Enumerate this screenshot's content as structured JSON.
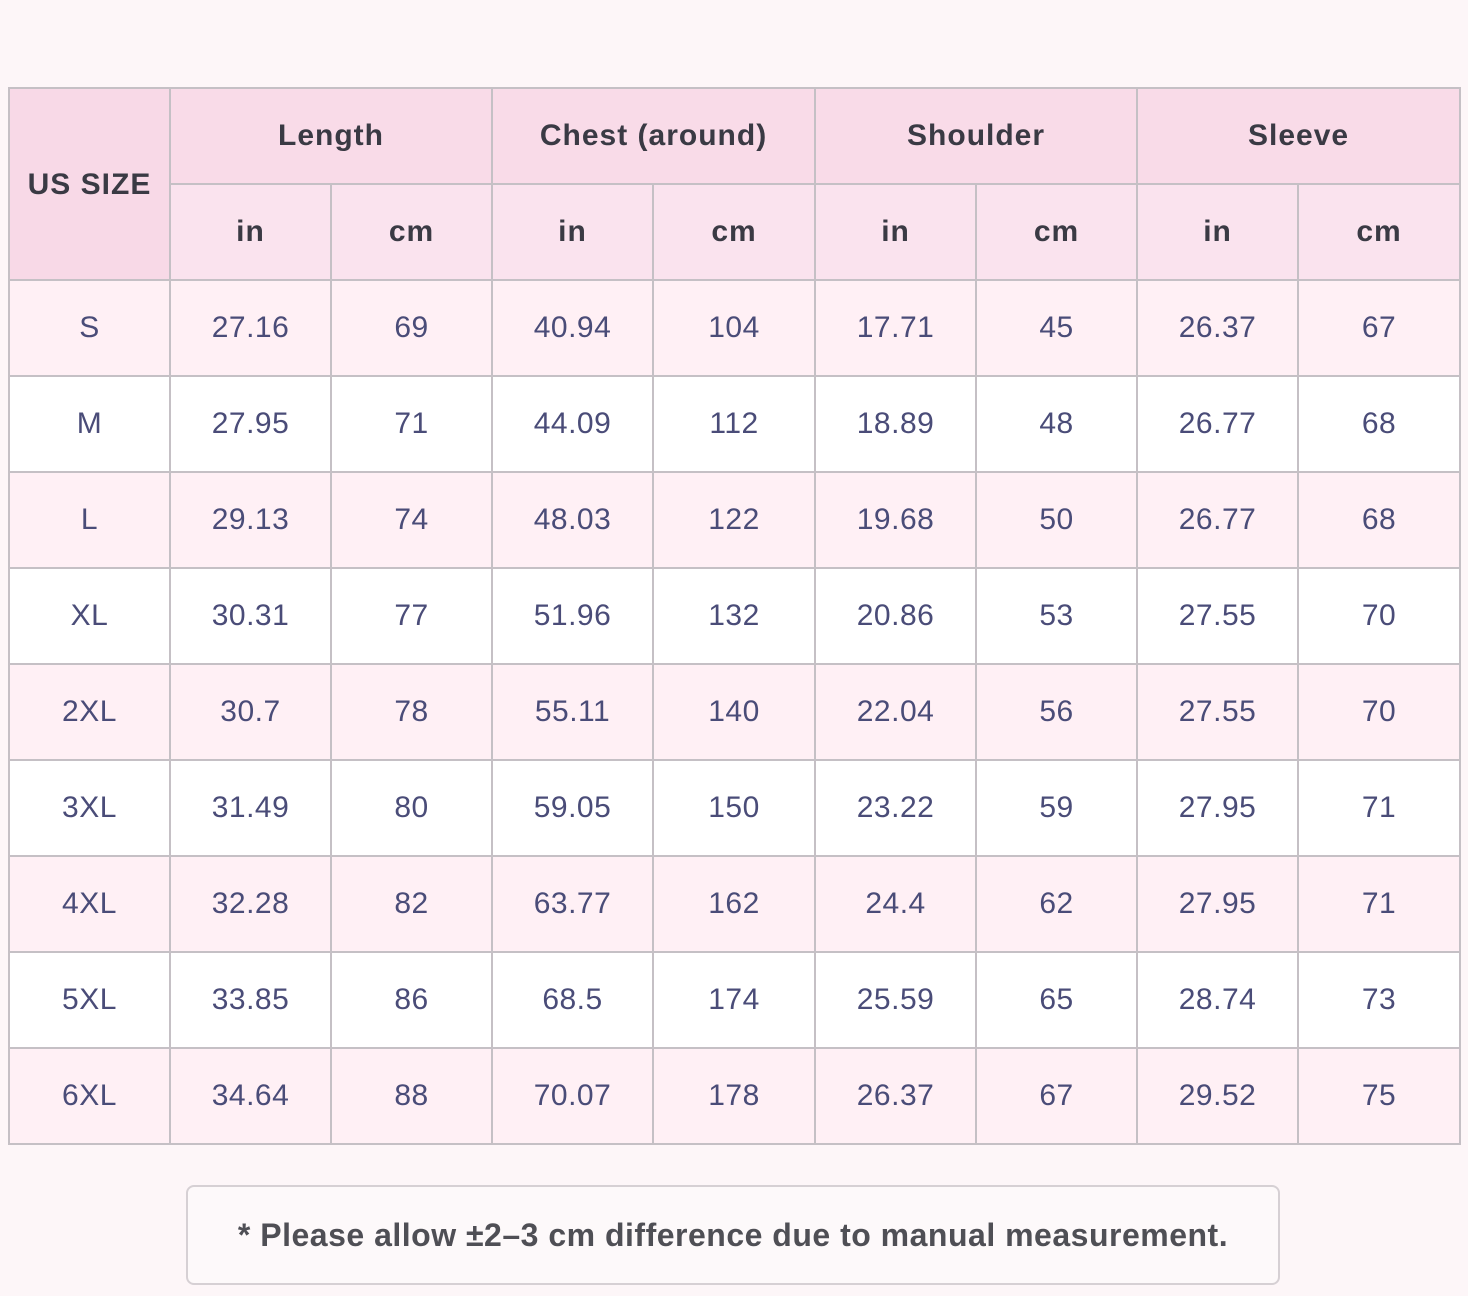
{
  "header": {
    "size_label": "US SIZE",
    "groups": [
      "Length",
      "Chest (around)",
      "Shoulder",
      "Sleeve"
    ],
    "units": [
      "in",
      "cm",
      "in",
      "cm",
      "in",
      "cm",
      "in",
      "cm"
    ]
  },
  "rows": [
    {
      "size": "S",
      "values": [
        "27.16",
        "69",
        "40.94",
        "104",
        "17.71",
        "45",
        "26.37",
        "67"
      ]
    },
    {
      "size": "M",
      "values": [
        "27.95",
        "71",
        "44.09",
        "112",
        "18.89",
        "48",
        "26.77",
        "68"
      ]
    },
    {
      "size": "L",
      "values": [
        "29.13",
        "74",
        "48.03",
        "122",
        "19.68",
        "50",
        "26.77",
        "68"
      ]
    },
    {
      "size": "XL",
      "values": [
        "30.31",
        "77",
        "51.96",
        "132",
        "20.86",
        "53",
        "27.55",
        "70"
      ]
    },
    {
      "size": "2XL",
      "values": [
        "30.7",
        "78",
        "55.11",
        "140",
        "22.04",
        "56",
        "27.55",
        "70"
      ]
    },
    {
      "size": "3XL",
      "values": [
        "31.49",
        "80",
        "59.05",
        "150",
        "23.22",
        "59",
        "27.95",
        "71"
      ]
    },
    {
      "size": "4XL",
      "values": [
        "32.28",
        "82",
        "63.77",
        "162",
        "24.4",
        "62",
        "27.95",
        "71"
      ]
    },
    {
      "size": "5XL",
      "values": [
        "33.85",
        "86",
        "68.5",
        "174",
        "25.59",
        "65",
        "28.74",
        "73"
      ]
    },
    {
      "size": "6XL",
      "values": [
        "34.64",
        "88",
        "70.07",
        "178",
        "26.37",
        "67",
        "29.52",
        "75"
      ]
    }
  ],
  "note": "* Please allow ±2–3 cm difference due to manual measurement.",
  "colors": {
    "header_bg": "#f9dbe8",
    "row_pink": "#fff0f5",
    "row_white": "#ffffff",
    "value_text": "#4a4c78",
    "header_text": "#3a3a44",
    "border": "#c5c0c5"
  }
}
